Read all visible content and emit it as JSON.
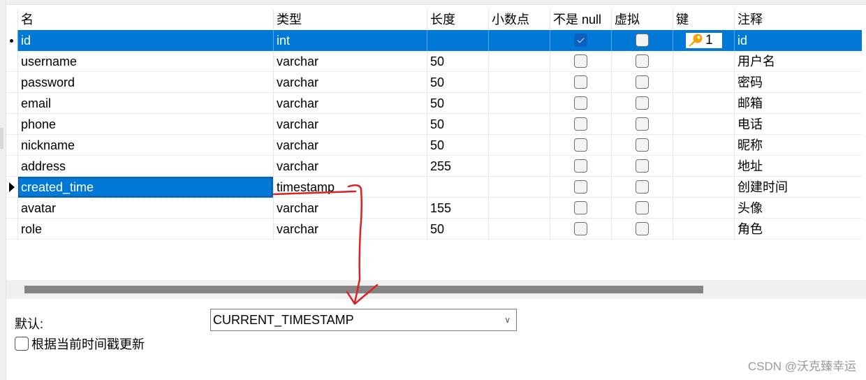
{
  "columns": [
    "名",
    "类型",
    "长度",
    "小数点",
    "不是 null",
    "虚拟",
    "键",
    "注释"
  ],
  "rows": [
    {
      "name": "id",
      "type": "int",
      "length": "",
      "decimals": "",
      "not_null": true,
      "virtual": false,
      "key": "1",
      "comment": "id",
      "indicator": "dot",
      "selected": true
    },
    {
      "name": "username",
      "type": "varchar",
      "length": "50",
      "decimals": "",
      "not_null": false,
      "virtual": false,
      "key": "",
      "comment": "用户名"
    },
    {
      "name": "password",
      "type": "varchar",
      "length": "50",
      "decimals": "",
      "not_null": false,
      "virtual": false,
      "key": "",
      "comment": "密码"
    },
    {
      "name": "email",
      "type": "varchar",
      "length": "50",
      "decimals": "",
      "not_null": false,
      "virtual": false,
      "key": "",
      "comment": "邮箱"
    },
    {
      "name": "phone",
      "type": "varchar",
      "length": "50",
      "decimals": "",
      "not_null": false,
      "virtual": false,
      "key": "",
      "comment": "电话"
    },
    {
      "name": "nickname",
      "type": "varchar",
      "length": "50",
      "decimals": "",
      "not_null": false,
      "virtual": false,
      "key": "",
      "comment": "昵称"
    },
    {
      "name": "address",
      "type": "varchar",
      "length": "255",
      "decimals": "",
      "not_null": false,
      "virtual": false,
      "key": "",
      "comment": "地址"
    },
    {
      "name": "created_time",
      "type": "timestamp",
      "length": "",
      "decimals": "",
      "not_null": false,
      "virtual": false,
      "key": "",
      "comment": "创建时间",
      "indicator": "arrow",
      "focused": true
    },
    {
      "name": "avatar",
      "type": "varchar",
      "length": "155",
      "decimals": "",
      "not_null": false,
      "virtual": false,
      "key": "",
      "comment": "头像"
    },
    {
      "name": "role",
      "type": "varchar",
      "length": "50",
      "decimals": "",
      "not_null": false,
      "virtual": false,
      "key": "",
      "comment": "角色"
    }
  ],
  "properties": {
    "default_label": "默认:",
    "default_value": "CURRENT_TIMESTAMP",
    "update_on_timestamp_label": "根据当前时间戳更新",
    "update_on_timestamp_checked": false
  },
  "colors": {
    "selection": "#0078d7",
    "annotation": "#e02020",
    "key_icon": "#f5a300"
  },
  "watermark": "CSDN @沃克臻幸运"
}
